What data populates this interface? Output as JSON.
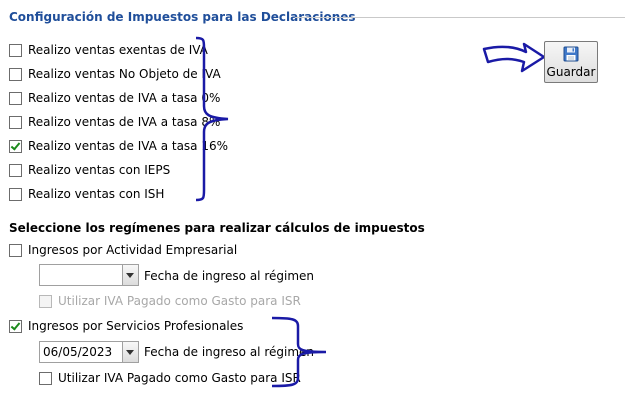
{
  "group_title": "Configuración de Impuestos para las Declaraciones",
  "sales_options": [
    {
      "label": "Realizo ventas exentas de IVA",
      "checked": false
    },
    {
      "label": "Realizo ventas No Objeto de IVA",
      "checked": false
    },
    {
      "label": "Realizo ventas de IVA a tasa 0%",
      "checked": false
    },
    {
      "label": "Realizo ventas de IVA a tasa 8%",
      "checked": false
    },
    {
      "label": "Realizo ventas de IVA a tasa 16%",
      "checked": true
    },
    {
      "label": "Realizo ventas con IEPS",
      "checked": false
    },
    {
      "label": "Realizo ventas con ISH",
      "checked": false
    }
  ],
  "save_button": {
    "label": "Guardar",
    "icon": "floppy-disk-icon"
  },
  "regimes_title": "Seleccione los regímenes para realizar cálculos de impuestos",
  "regime_business": {
    "label": "Ingresos por Actividad Empresarial",
    "checked": false,
    "date_value": "",
    "date_label": "Fecha de ingreso al régimen",
    "iva_label": "Utilizar IVA Pagado como Gasto para ISR",
    "iva_checked": false,
    "iva_enabled": false
  },
  "regime_professional": {
    "label": "Ingresos por Servicios Profesionales",
    "checked": true,
    "date_value": "06/05/2023",
    "date_label": "Fecha de ingreso al régimen",
    "iva_label": "Utilizar IVA Pagado como Gasto para ISR",
    "iva_checked": false,
    "iva_enabled": true
  },
  "annotation_color": "#1a1aa6"
}
